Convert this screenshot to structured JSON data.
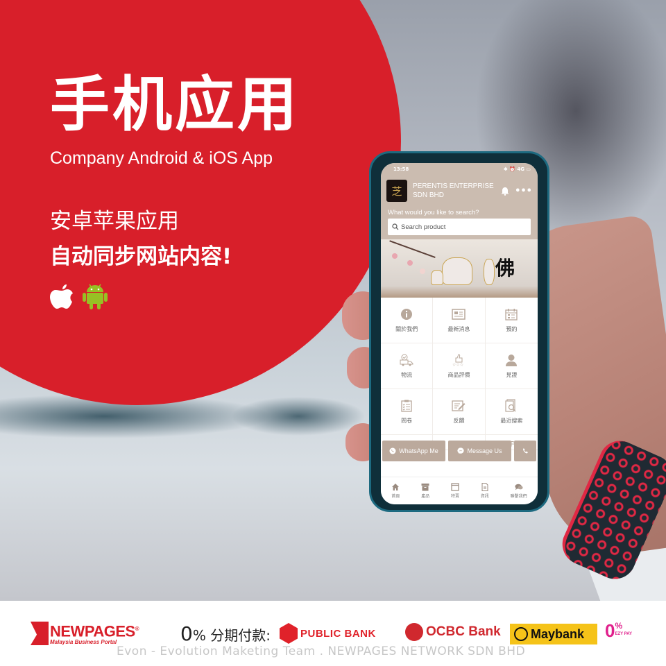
{
  "hero": {
    "title": "手机应用",
    "subtitle": "Company Android & iOS App",
    "line1": "安卓苹果应用",
    "line2": "自动同步网站内容!",
    "os_icons": [
      "apple-icon",
      "android-icon"
    ]
  },
  "colors": {
    "brand_red": "#d81f2a",
    "app_theme": "#cbbcb0",
    "action_button": "#bba99c",
    "android_green": "#97c024"
  },
  "phone": {
    "status": {
      "time": "13:58",
      "right": "✱ ⏰ 4G ▭"
    },
    "app": {
      "company_name_line1": "PERENTIS ENTERPRISE",
      "company_name_line2": "SDN BHD",
      "search_prompt": "What would you like to search?",
      "search_placeholder": "Search product",
      "banner_text": "佛"
    },
    "menu": [
      {
        "label": "關於我們",
        "icon": "info-icon"
      },
      {
        "label": "最新消息",
        "icon": "newspaper-icon"
      },
      {
        "label": "預約",
        "icon": "calendar-icon"
      },
      {
        "label": "物流",
        "icon": "delivery-truck-icon"
      },
      {
        "label": "商品評價",
        "icon": "thumbs-up-rating-icon"
      },
      {
        "label": "見證",
        "icon": "user-icon"
      },
      {
        "label": "問卷",
        "icon": "checklist-icon"
      },
      {
        "label": "反饋",
        "icon": "feedback-edit-icon"
      },
      {
        "label": "最近搜索",
        "icon": "recent-search-icon"
      }
    ],
    "actions": {
      "whatsapp": "WhatsApp Me",
      "message": "Message Us"
    },
    "tabs": [
      {
        "label": "首頁",
        "icon": "home-icon"
      },
      {
        "label": "產品",
        "icon": "archive-box-icon"
      },
      {
        "label": "特賣",
        "icon": "window-icon"
      },
      {
        "label": "資訊",
        "icon": "document-icon"
      },
      {
        "label": "聯繫我們",
        "icon": "chat-bubbles-icon"
      }
    ]
  },
  "footer": {
    "brand": "NEWPAGES",
    "brand_reg": "®",
    "brand_tagline": "Malaysia Business Portal",
    "installment_big": "0",
    "installment_text": "% 分期付款:",
    "banks": [
      "PUBLIC BANK",
      "OCBC Bank",
      "Maybank"
    ],
    "ezypay_big": "0",
    "ezypay_pct": "%",
    "ezypay_label": "EZY PAY",
    "watermark": "Evon - Evolution Maketing Team . NEWPAGES NETWORK SDN BHD"
  }
}
